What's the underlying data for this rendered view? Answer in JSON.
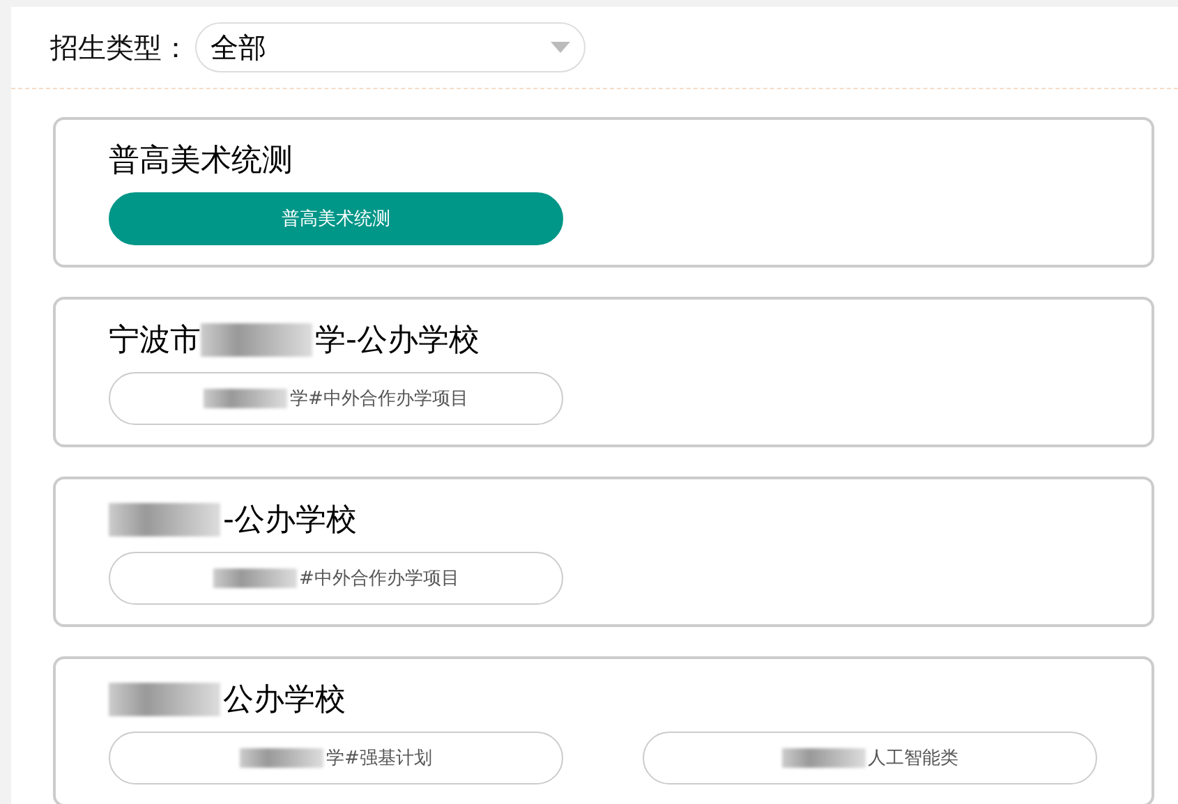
{
  "filter": {
    "label": "招生类型：",
    "value": "全部"
  },
  "cards": [
    {
      "title": [
        {
          "kind": "text",
          "text": "普高美术统测"
        }
      ],
      "options": [
        {
          "selected": true,
          "parts": [
            {
              "kind": "text",
              "text": "普高美术统测"
            }
          ]
        }
      ]
    },
    {
      "title": [
        {
          "kind": "text",
          "text": "宁波市"
        },
        {
          "kind": "redacted"
        },
        {
          "kind": "text",
          "text": "学-公办学校"
        }
      ],
      "options": [
        {
          "selected": false,
          "parts": [
            {
              "kind": "redacted"
            },
            {
              "kind": "text",
              "text": "学#中外合作办学项目"
            }
          ]
        }
      ]
    },
    {
      "title": [
        {
          "kind": "redacted"
        },
        {
          "kind": "text",
          "text": "-公办学校"
        }
      ],
      "options": [
        {
          "selected": false,
          "parts": [
            {
              "kind": "redacted"
            },
            {
              "kind": "text",
              "text": "#中外合作办学项目"
            }
          ]
        }
      ]
    },
    {
      "title": [
        {
          "kind": "redacted"
        },
        {
          "kind": "text",
          "text": "公办学校"
        }
      ],
      "options": [
        {
          "selected": false,
          "parts": [
            {
              "kind": "redacted"
            },
            {
              "kind": "text",
              "text": "学#强基计划"
            }
          ]
        },
        {
          "selected": false,
          "parts": [
            {
              "kind": "redacted"
            },
            {
              "kind": "text",
              "text": "人工智能类"
            }
          ]
        }
      ]
    }
  ]
}
